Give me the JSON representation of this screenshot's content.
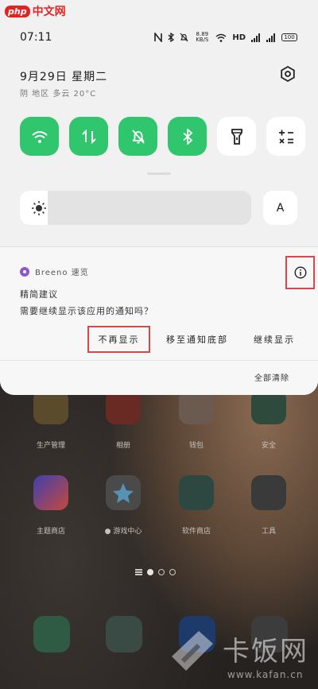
{
  "watermark_top": {
    "php": "php",
    "site": "中文网"
  },
  "watermark_bottom": {
    "brand": "卡饭网",
    "url": "www.kafan.cn"
  },
  "status_bar": {
    "time": "07:11",
    "network": "HD",
    "battery": "100",
    "speed": "8.89 KB/S"
  },
  "header": {
    "date": "9月29日  星期二",
    "weather": "阴 地区 多云 20°C"
  },
  "quick_tiles": [
    {
      "name": "wifi",
      "on": true
    },
    {
      "name": "mobile-data",
      "on": true
    },
    {
      "name": "silent",
      "on": true
    },
    {
      "name": "bluetooth",
      "on": true
    },
    {
      "name": "flashlight",
      "on": false
    },
    {
      "name": "calculator",
      "on": false
    }
  ],
  "brightness": {
    "level": 0.12,
    "auto_label": "A"
  },
  "notification": {
    "app_name": "Breeno 速览",
    "title": "精简建议",
    "body": "需要继续显示该应用的通知吗？",
    "actions": [
      "不再显示",
      "移至通知底部",
      "继续显示"
    ],
    "clear_all": "全部清除"
  },
  "home_apps": {
    "row1": [
      "生产管理",
      "相册",
      "钱包",
      "安全"
    ],
    "row2": [
      "主题商店",
      "● 游戏中心",
      "软件商店",
      "工具"
    ]
  },
  "colors": {
    "tile_on": "#2fc66e",
    "highlight": "#d44a4a",
    "app_icon": "#8f56c9"
  }
}
